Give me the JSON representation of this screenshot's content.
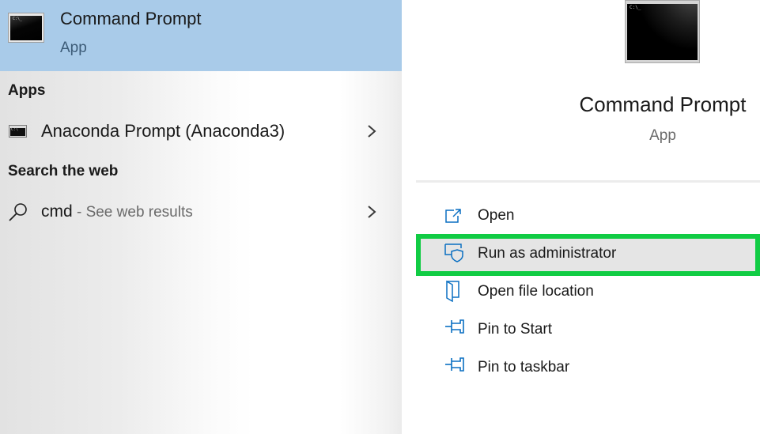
{
  "best_match": {
    "title": "Command Prompt",
    "subtitle": "App",
    "icon": "command-prompt-icon"
  },
  "sections": {
    "apps_heading": "Apps",
    "web_heading": "Search the web"
  },
  "apps": [
    {
      "label": "Anaconda Prompt (Anaconda3)",
      "icon": "anaconda-prompt-icon"
    }
  ],
  "web_search": {
    "query": "cmd",
    "suffix": " - See web results",
    "icon": "search-icon"
  },
  "detail": {
    "title": "Command Prompt",
    "subtitle": "App"
  },
  "actions": [
    {
      "label": "Open",
      "icon": "open-icon"
    },
    {
      "label": "Run as administrator",
      "icon": "shield-icon",
      "highlighted": true
    },
    {
      "label": "Open file location",
      "icon": "folder-icon"
    },
    {
      "label": "Pin to Start",
      "icon": "pin-icon"
    },
    {
      "label": "Pin to taskbar",
      "icon": "pin-icon"
    }
  ],
  "colors": {
    "selection_blue": "#a9cbe9",
    "icon_blue": "#0a6fc2",
    "highlight_green": "#11cc44"
  }
}
